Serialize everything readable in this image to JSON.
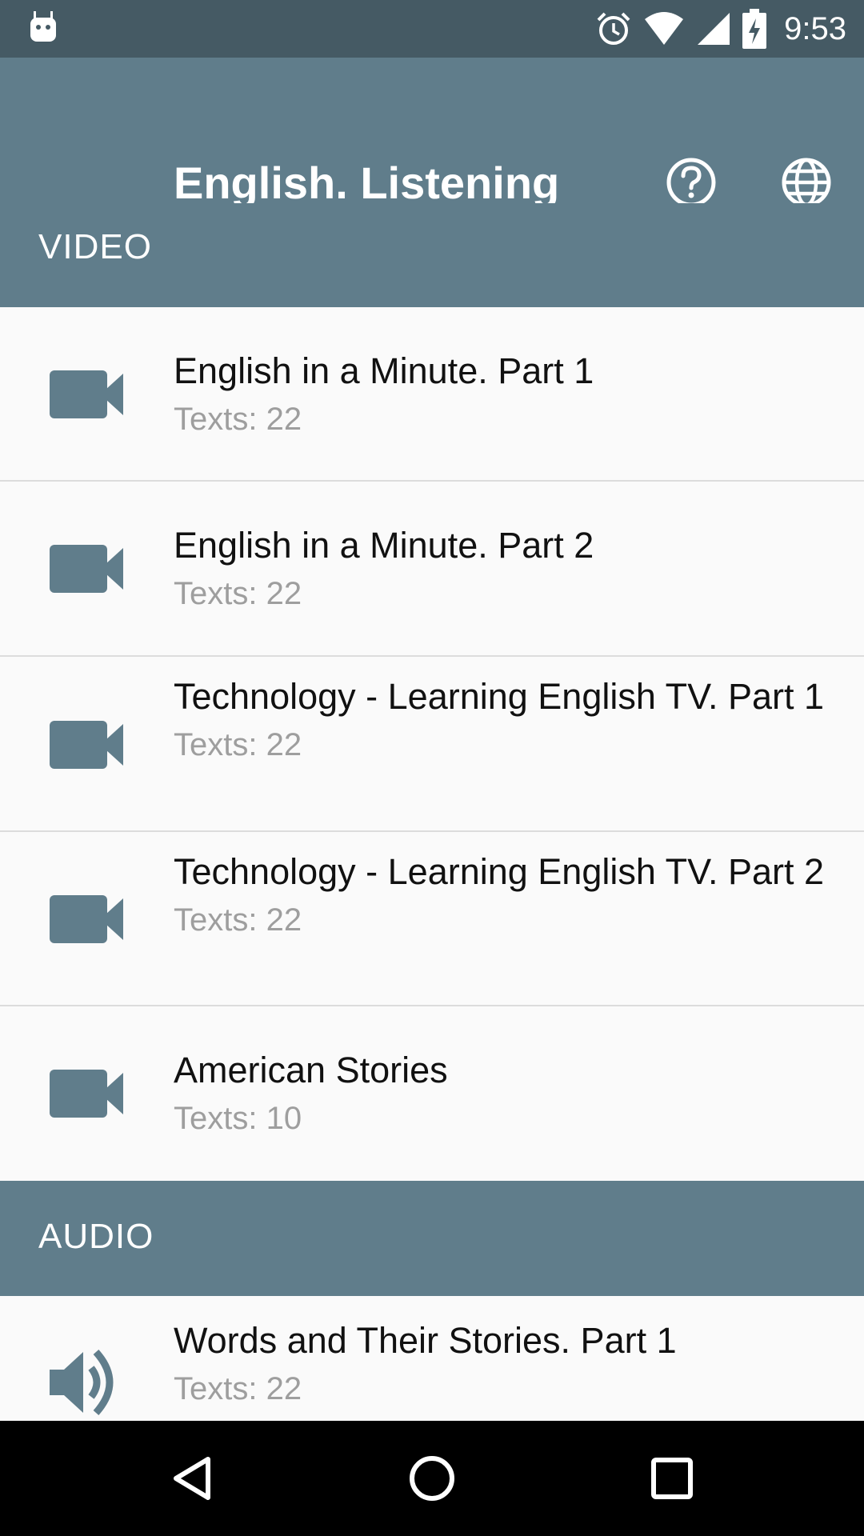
{
  "status_bar": {
    "time": "9:53",
    "icons": [
      "android-notification-icon",
      "alarm-icon",
      "wifi-icon",
      "cell-signal-icon",
      "battery-charging-icon"
    ]
  },
  "app_bar": {
    "title": "English. Listening",
    "actions": [
      "help-icon",
      "globe-icon"
    ]
  },
  "sections": [
    {
      "label": "VIDEO",
      "items": [
        {
          "title": "English in a Minute. Part 1",
          "subtitle": "Texts: 22",
          "icon": "video-camera-icon"
        },
        {
          "title": "English in a Minute. Part 2",
          "subtitle": "Texts: 22",
          "icon": "video-camera-icon"
        },
        {
          "title": "Technology - Learning English TV. Part 1",
          "subtitle": "Texts: 22",
          "icon": "video-camera-icon"
        },
        {
          "title": "Technology - Learning English TV. Part 2",
          "subtitle": "Texts: 22",
          "icon": "video-camera-icon"
        },
        {
          "title": "American Stories",
          "subtitle": "Texts: 10",
          "icon": "video-camera-icon"
        }
      ]
    },
    {
      "label": "AUDIO",
      "items": [
        {
          "title": "Words and Their Stories. Part 1",
          "subtitle": "Texts: 22",
          "icon": "speaker-icon"
        }
      ]
    }
  ],
  "nav_bar": {
    "buttons": [
      "back-icon",
      "home-icon",
      "recents-icon"
    ]
  },
  "colors": {
    "primary": "#607d8b",
    "primary_dark": "#455a64",
    "icon": "#607d8b",
    "subtitle": "#9e9e9e"
  }
}
